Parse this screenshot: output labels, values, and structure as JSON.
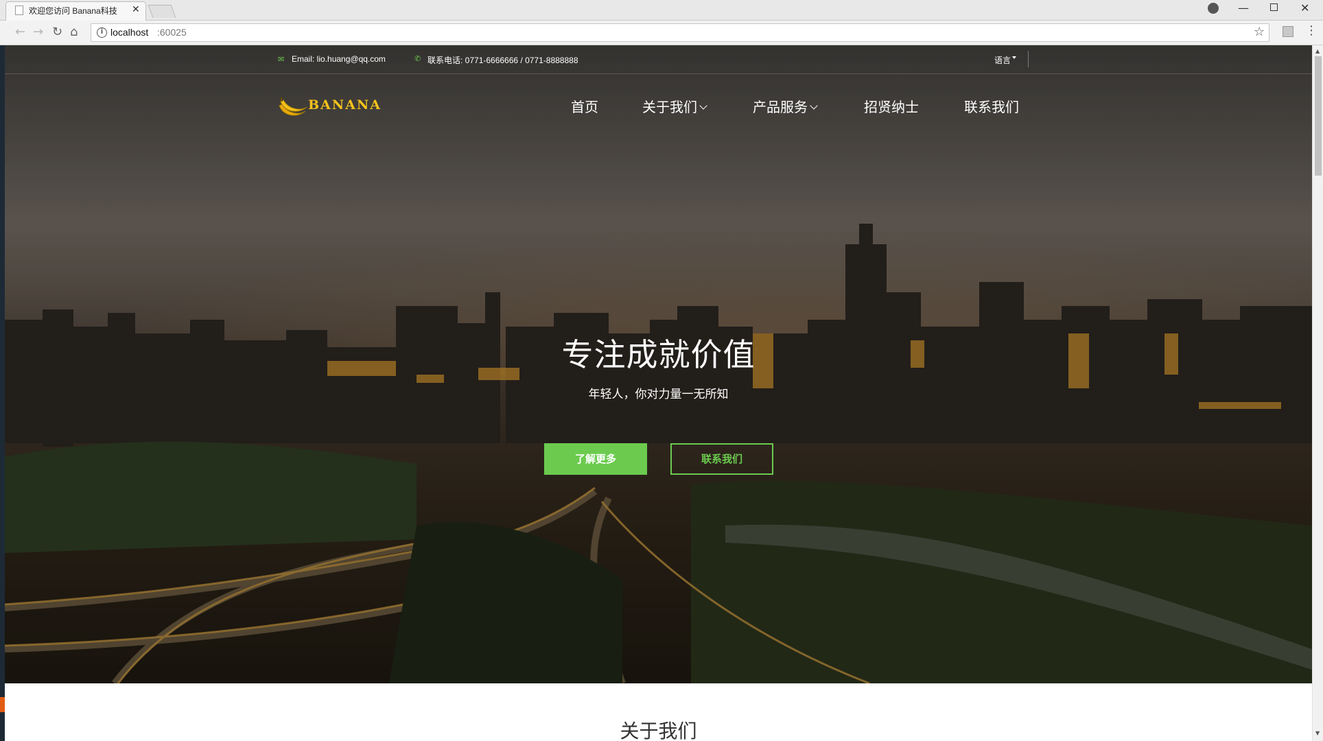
{
  "browser": {
    "tab_title": "欢迎您访问 Banana科技",
    "tab_close": "✕",
    "url_host": "localhost",
    "url_port": ":60025"
  },
  "icons": {
    "back": "arrow-left",
    "forward": "arrow-right",
    "reload": "reload",
    "home": "home",
    "info": "info-circle",
    "star": "star-outline",
    "menu": "kebab-menu",
    "email": "envelope",
    "phone": "phone"
  },
  "topbar": {
    "email": "Email: lio.huang@qq.com",
    "phone": "联系电话: 0771-6666666 / 0771-8888888",
    "language": "语言"
  },
  "logo": {
    "text": "BANANA"
  },
  "nav": {
    "home": "首页",
    "about": "关于我们",
    "products": "产品服务",
    "jobs": "招贤纳士",
    "contact": "联系我们"
  },
  "hero": {
    "title": "专注成就价值",
    "subtitle": "年轻人，你对力量一无所知",
    "btn_more": "了解更多",
    "btn_contact": "联系我们"
  },
  "section": {
    "about_heading": "关于我们"
  },
  "colors": {
    "accent": "#6ccb4f",
    "logo_yellow": "#f4c21b"
  }
}
